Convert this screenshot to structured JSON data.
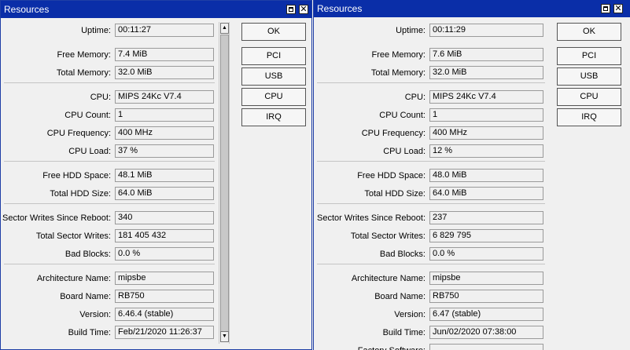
{
  "left": {
    "title": "Resources",
    "buttons": [
      "OK",
      "PCI",
      "USB",
      "CPU",
      "IRQ"
    ],
    "fields": [
      {
        "label": "Uptime:",
        "value": "00:11:27"
      },
      {
        "label": "Free Memory:",
        "value": "7.4 MiB"
      },
      {
        "label": "Total Memory:",
        "value": "32.0 MiB"
      },
      {
        "label": "CPU:",
        "value": "MIPS 24Kc V7.4"
      },
      {
        "label": "CPU Count:",
        "value": "1"
      },
      {
        "label": "CPU Frequency:",
        "value": "400 MHz"
      },
      {
        "label": "CPU Load:",
        "value": "37 %"
      },
      {
        "label": "Free HDD Space:",
        "value": "48.1 MiB"
      },
      {
        "label": "Total HDD Size:",
        "value": "64.0 MiB"
      },
      {
        "label": "Sector Writes Since Reboot:",
        "value": "340"
      },
      {
        "label": "Total Sector Writes:",
        "value": "181 405 432"
      },
      {
        "label": "Bad Blocks:",
        "value": "0.0 %"
      },
      {
        "label": "Architecture Name:",
        "value": "mipsbe"
      },
      {
        "label": "Board Name:",
        "value": "RB750"
      },
      {
        "label": "Version:",
        "value": "6.46.4 (stable)"
      },
      {
        "label": "Build Time:",
        "value": "Feb/21/2020 11:26:37"
      }
    ]
  },
  "right": {
    "title": "Resources",
    "buttons": [
      "OK",
      "PCI",
      "USB",
      "CPU",
      "IRQ"
    ],
    "fields": [
      {
        "label": "Uptime:",
        "value": "00:11:29"
      },
      {
        "label": "Free Memory:",
        "value": "7.6 MiB"
      },
      {
        "label": "Total Memory:",
        "value": "32.0 MiB"
      },
      {
        "label": "CPU:",
        "value": "MIPS 24Kc V7.4"
      },
      {
        "label": "CPU Count:",
        "value": "1"
      },
      {
        "label": "CPU Frequency:",
        "value": "400 MHz"
      },
      {
        "label": "CPU Load:",
        "value": "12 %"
      },
      {
        "label": "Free HDD Space:",
        "value": "48.0 MiB"
      },
      {
        "label": "Total HDD Size:",
        "value": "64.0 MiB"
      },
      {
        "label": "Sector Writes Since Reboot:",
        "value": "237"
      },
      {
        "label": "Total Sector Writes:",
        "value": "6 829 795"
      },
      {
        "label": "Bad Blocks:",
        "value": "0.0 %"
      },
      {
        "label": "Architecture Name:",
        "value": "mipsbe"
      },
      {
        "label": "Board Name:",
        "value": "RB750"
      },
      {
        "label": "Version:",
        "value": "6.47 (stable)"
      },
      {
        "label": "Build Time:",
        "value": "Jun/02/2020 07:38:00"
      },
      {
        "label": "Factory Software:",
        "value": ""
      }
    ]
  }
}
